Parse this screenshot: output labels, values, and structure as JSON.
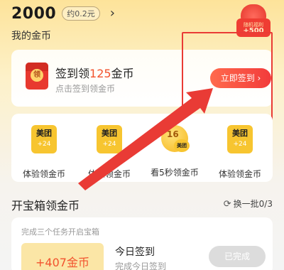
{
  "header": {
    "coins_value": "2000",
    "approx_value": "约0.2元",
    "my_coins_label": "我的金币"
  },
  "gift_box": {
    "caption": "随机福利",
    "amount": "+500"
  },
  "signin": {
    "title_prefix": "签到领",
    "title_amount": "125",
    "title_suffix": "金币",
    "subtitle": "点击签到领金币",
    "icon_text": "领",
    "button_label": "立即签到 ›"
  },
  "tasks": [
    {
      "label": "体验领金币",
      "icon": "meituan-icon",
      "brand": "美团",
      "amount": "+24"
    },
    {
      "label": "体验领金币",
      "icon": "meituan-icon",
      "brand": "美团",
      "amount": "+24"
    },
    {
      "label": "看5秒领金币",
      "icon": "coin-timer-icon",
      "brand": "美团",
      "amount": "16"
    },
    {
      "label": "体验领金币",
      "icon": "meituan-icon",
      "brand": "美团",
      "amount": "+24"
    }
  ],
  "chest_section": {
    "title": "开宝箱领金币",
    "refresh_label": "换一批0/3",
    "tip": "完成三个任务开启宝箱",
    "reward_amount": "+407金币",
    "task_title": "今日签到",
    "task_subtitle": "完成今日签到",
    "done_label": "已完成"
  },
  "colors": {
    "accent": "#f2532e",
    "annotation": "#e93b35",
    "brand_yellow": "#f7c530"
  }
}
